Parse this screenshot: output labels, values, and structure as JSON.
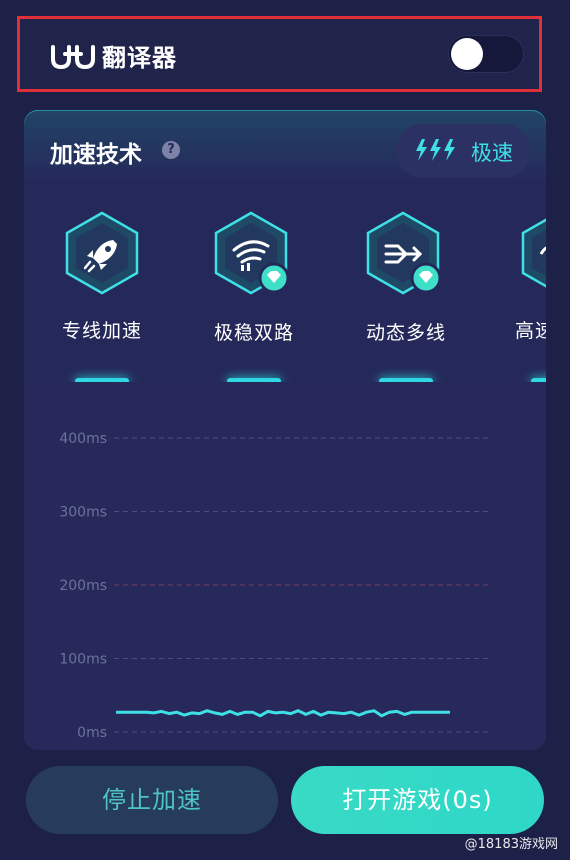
{
  "translator": {
    "logo_text": "UU",
    "title": "翻译器",
    "toggle_on": false
  },
  "accel_section": {
    "title": "加速技术",
    "help_icon": "question-circle-icon",
    "speed_mode": "极速",
    "speed_icon": "lightning-bolts-icon"
  },
  "features": [
    {
      "label": "专线加速",
      "icon": "rocket-icon",
      "premium": false
    },
    {
      "label": "极稳双路",
      "icon": "dual-wifi-icon",
      "premium": true
    },
    {
      "label": "动态多线",
      "icon": "multi-line-icon",
      "premium": true
    },
    {
      "label": "高速",
      "icon": "wave-icon",
      "premium": false
    }
  ],
  "chart_data": {
    "type": "line",
    "ylabel": "",
    "xlabel": "",
    "yticks": [
      "400ms",
      "300ms",
      "200ms",
      "100ms",
      "0ms"
    ],
    "ylim": [
      0,
      400
    ],
    "grid": true,
    "highlight_gridline": "200ms",
    "series": [
      {
        "color": "#3ee0e6",
        "values": [
          27,
          27,
          27,
          27,
          27,
          26,
          28,
          25,
          27,
          23,
          26,
          25,
          29,
          26,
          24,
          28,
          24,
          27,
          27,
          22,
          28,
          26,
          27,
          25,
          29,
          24,
          28,
          23,
          27,
          26,
          25,
          27,
          23,
          27,
          29,
          22,
          27,
          28,
          24,
          27,
          27,
          27,
          27,
          27,
          27
        ]
      }
    ]
  },
  "buttons": {
    "stop": "停止加速",
    "open_game": "打开游戏(0s)"
  },
  "watermark": "@18183游戏网",
  "colors": {
    "background": "#1e2147",
    "accent": "#3ee0e6",
    "highlight_border": "#e0303a"
  }
}
